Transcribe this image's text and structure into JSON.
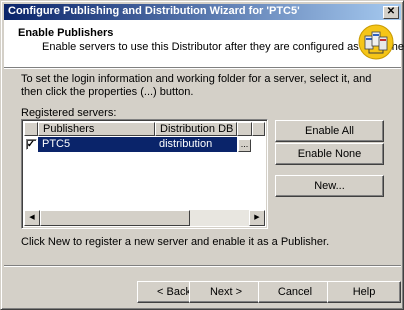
{
  "window": {
    "title": "Configure Publishing and Distribution Wizard for 'PTC5'",
    "close_glyph": "✕"
  },
  "header": {
    "title": "Enable Publishers",
    "subtitle": "Enable servers to use this Distributor after they are configured as Publishers.",
    "icon": "servers-wizard-icon"
  },
  "instructions": "To set the login information and working folder for a server, select it, and then click the properties (...) button.",
  "registered_label": "Registered servers:",
  "table": {
    "columns": [
      "Publishers",
      "Distribution DB"
    ],
    "rows": [
      {
        "checked": "✓",
        "publisher": "PTC5",
        "distribution_db": "distribution",
        "properties": "..."
      }
    ]
  },
  "side_buttons": {
    "enable_all": "Enable All",
    "enable_none": "Enable None",
    "new": "New..."
  },
  "note": "Click New to register a new server and enable it as a Publisher.",
  "footer": {
    "back": "< Back",
    "next": "Next >",
    "cancel": "Cancel",
    "help": "Help"
  },
  "colors": {
    "title_gradient_start": "#0a246a",
    "title_gradient_end": "#a6caf0",
    "selection": "#0a246a",
    "face": "#d4d0c8"
  }
}
